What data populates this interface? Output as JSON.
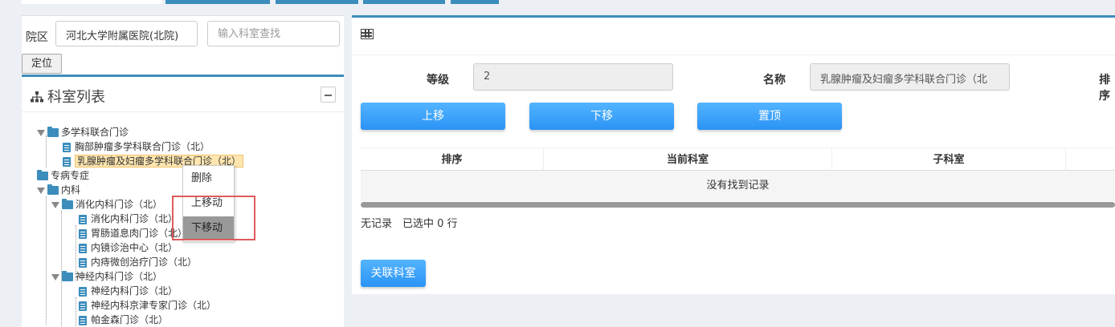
{
  "top_tabs": [
    "",
    "",
    "",
    "",
    ""
  ],
  "left": {
    "campus_label": "院区",
    "campus_value": "河北大学附属医院(北院)",
    "search_placeholder": "输入科室查找",
    "locate_label": "定位",
    "box_title": "科室列表",
    "tree": [
      {
        "label": "多学科联合门诊",
        "type": "folder",
        "expanded": true
      },
      {
        "label": "胸部肿瘤多学科联合门诊（北）",
        "type": "leaf"
      },
      {
        "label": "乳腺肿瘤及妇瘤多学科联合门诊（北）",
        "type": "leaf",
        "selected": true
      },
      {
        "label": "专病专症",
        "type": "folder",
        "expanded": false
      },
      {
        "label": "内科",
        "type": "folder",
        "expanded": true
      },
      {
        "label": "消化内科门诊（北）",
        "type": "folder",
        "expanded": true
      },
      {
        "label": "消化内科门诊（北）",
        "type": "leaf"
      },
      {
        "label": "胃肠道息肉门诊（北）",
        "type": "leaf"
      },
      {
        "label": "内镜诊治中心（北）",
        "type": "leaf"
      },
      {
        "label": "内痔微创治疗门诊（北）",
        "type": "leaf"
      },
      {
        "label": "神经内科门诊（北）",
        "type": "folder",
        "expanded": true
      },
      {
        "label": "神经内科门诊（北）",
        "type": "leaf"
      },
      {
        "label": "神经内科京津专家门诊（北）",
        "type": "leaf"
      },
      {
        "label": "帕金森门诊（北）",
        "type": "leaf"
      }
    ],
    "context_menu": [
      "删除",
      "上移动",
      "下移动"
    ]
  },
  "right": {
    "level_label": "等级",
    "level_value": "2",
    "name_label": "名称",
    "name_value": "乳腺肿瘤及妇瘤多学科联合门诊（北",
    "sort_label_partial": "排序",
    "buttons": {
      "up": "上移",
      "down": "下移",
      "top": "置顶",
      "link": "关联科室"
    },
    "columns": [
      "排序",
      "当前科室",
      "子科室",
      ""
    ],
    "empty_text": "没有找到记录",
    "pager_text": "无记录　已选中 0 行"
  },
  "colors": {
    "accent": "#3c8dbc",
    "button": "#2a93f5",
    "highlight_box": "#e05a5a"
  }
}
